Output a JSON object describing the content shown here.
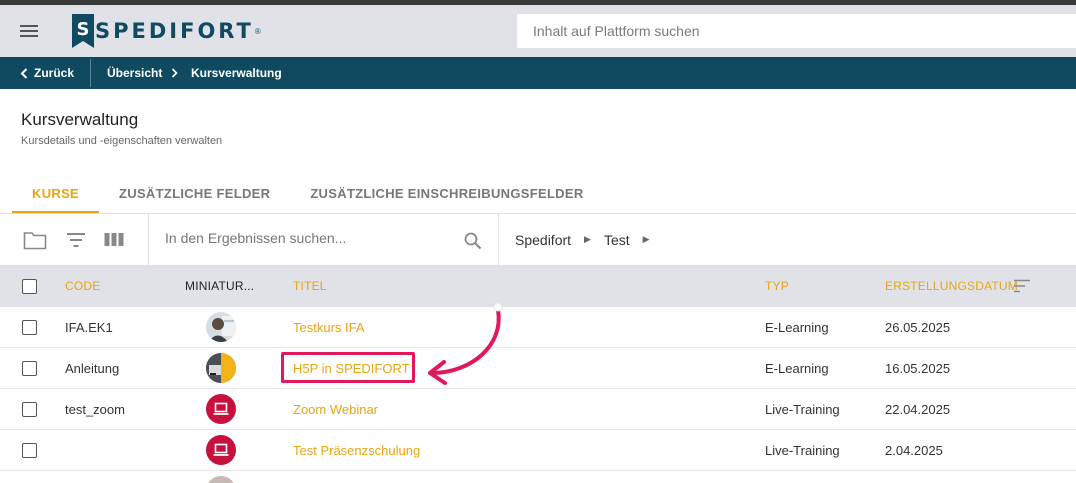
{
  "header": {
    "logo_text": "SPEDIFORT",
    "logo_reg": "®",
    "search_placeholder": "Inhalt auf Plattform suchen"
  },
  "nav": {
    "back_label": "Zurück",
    "crumbs": [
      "Übersicht",
      "Kursverwaltung"
    ]
  },
  "page": {
    "title": "Kursverwaltung",
    "subtitle": "Kursdetails und -eigenschaften verwalten"
  },
  "tabs": [
    {
      "label": "KURSE",
      "active": true
    },
    {
      "label": "ZUSÄTZLICHE FELDER",
      "active": false
    },
    {
      "label": "ZUSÄTZLICHE EINSCHREIBUNGSFELDER",
      "active": false
    }
  ],
  "toolbar": {
    "search_placeholder": "In den Ergebnissen suchen...",
    "folder_path": [
      "Spedifort",
      "Test"
    ]
  },
  "table": {
    "columns": {
      "code": "CODE",
      "thumb": "MINIATUR...",
      "title": "TITEL",
      "type": "TYP",
      "date": "ERSTELLUNGSDATUM"
    },
    "rows": [
      {
        "code": "IFA.EK1",
        "title": "Testkurs IFA",
        "type": "E-Learning",
        "date": "26.05.2025",
        "thumb": "photo-person"
      },
      {
        "code": "Anleitung",
        "title": "H5P in SPEDIFORT",
        "type": "E-Learning",
        "date": "16.05.2025",
        "thumb": "photo-truck"
      },
      {
        "code": "test_zoom",
        "title": "Zoom Webinar",
        "type": "Live-Training",
        "date": "22.04.2025",
        "thumb": "live-training-icon"
      },
      {
        "code": "",
        "title": "Test Präsenzschulung",
        "type": "Live-Training",
        "date": "2.04.2025",
        "thumb": "live-training-icon"
      }
    ]
  },
  "colors": {
    "accent": "#e8a510",
    "nav": "#0f4a61",
    "header_bg": "#e1e2e8",
    "annotation": "#e0195a",
    "live": "#c8103e"
  }
}
